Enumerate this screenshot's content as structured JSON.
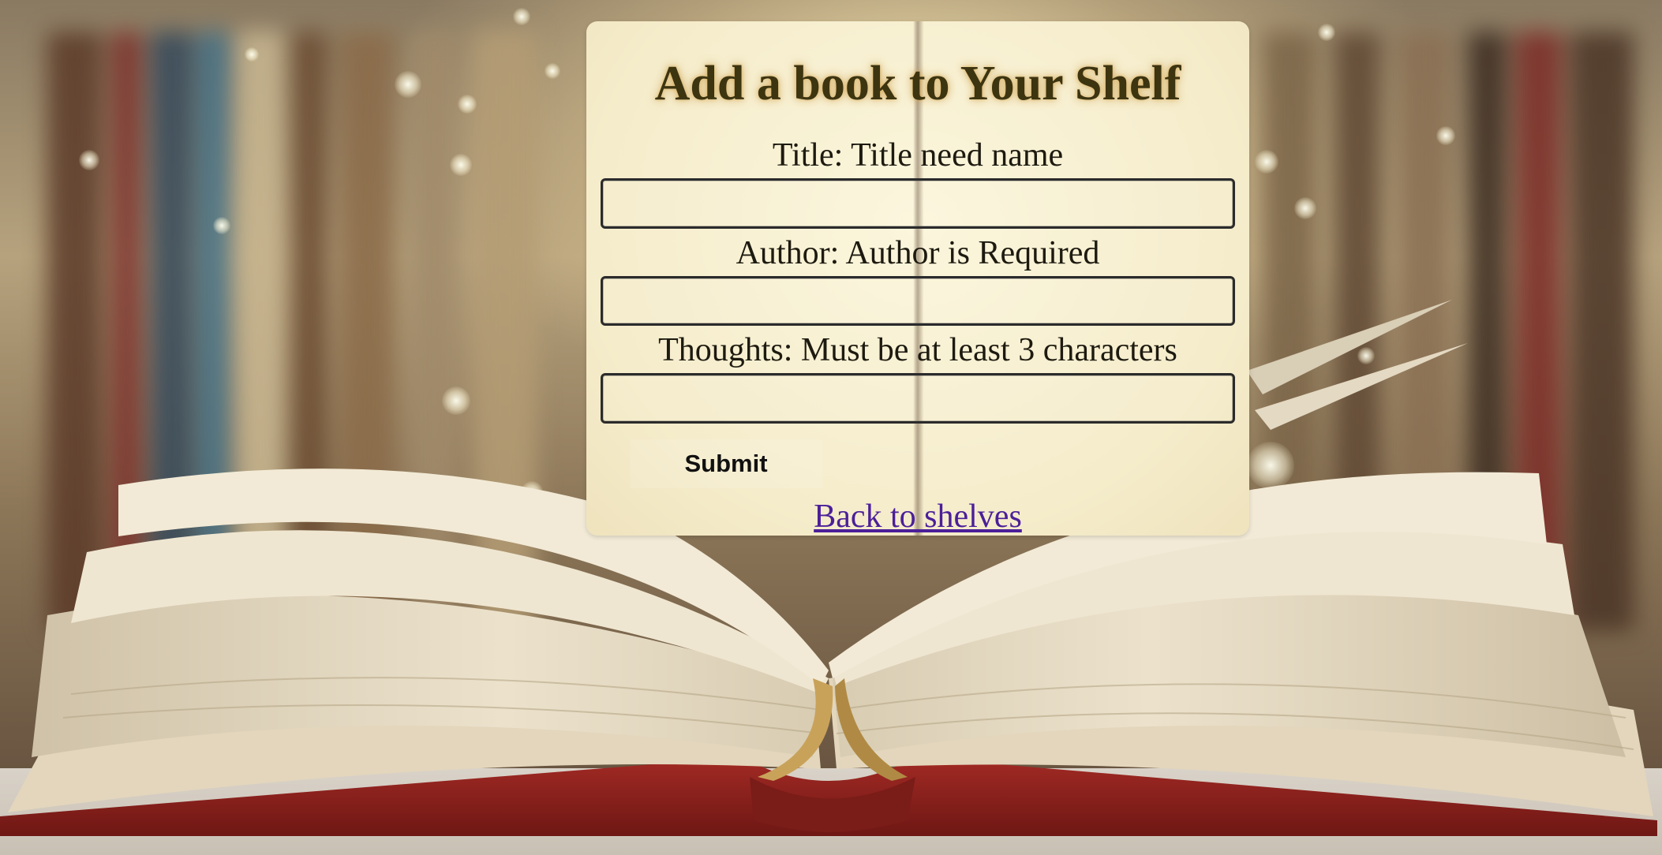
{
  "page": {
    "title": "Add a book to Your Shelf"
  },
  "form": {
    "fields": [
      {
        "name": "Title",
        "label": "Title:",
        "error": "Title need name",
        "value": "",
        "placeholder": ""
      },
      {
        "name": "Author",
        "label": "Author:",
        "error": "Author is Required",
        "value": "",
        "placeholder": ""
      },
      {
        "name": "Thoughts",
        "label": "Thoughts:",
        "error": "Must be at least 3 characters",
        "value": "",
        "placeholder": ""
      }
    ],
    "submit_label": "Submit"
  },
  "nav": {
    "back_link": "Back to shelves"
  },
  "theme": {
    "title_color": "#3d3410",
    "link_color": "#4b1f99",
    "card_color": "#f7efcf",
    "book_cover_color": "#8e1f1c"
  },
  "background": {
    "image_subject": "open-book-on-library-table"
  }
}
